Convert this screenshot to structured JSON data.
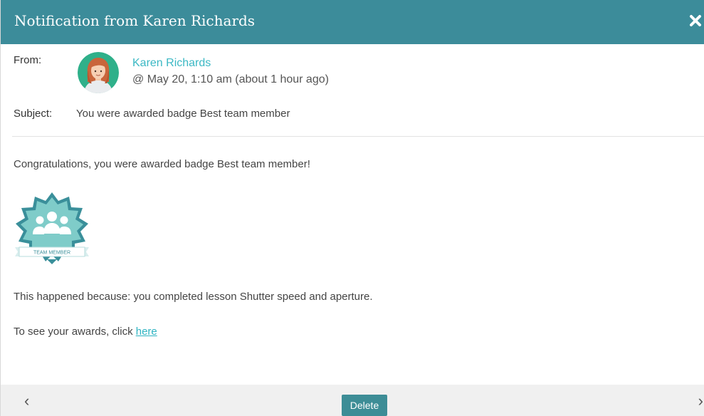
{
  "header": {
    "title": "Notification from Karen Richards",
    "close_icon": "close-icon",
    "bg_color": "#3c8c9a"
  },
  "from": {
    "label": "From:",
    "avatar_icon": "avatar-woman",
    "sender_name": "Karen Richards",
    "timestamp": "@ May 20, 1:10 am (about 1 hour ago)"
  },
  "subject": {
    "label": "Subject:",
    "text": "You were awarded badge Best team member"
  },
  "body": {
    "congrats": "Congratulations, you were awarded badge Best team member!",
    "badge_label": "TEAM MEMBER",
    "reason": "This happened because: you completed lesson Shutter speed and aperture.",
    "awards_prefix": "To see your awards, click ",
    "awards_link": "here"
  },
  "footer": {
    "prev_icon": "chevron-left-icon",
    "next_icon": "chevron-right-icon",
    "prev_glyph": "‹",
    "next_glyph": "›",
    "delete_label": "Delete"
  },
  "colors": {
    "accent": "#3bb8c4",
    "delete_button": "#3d8d96"
  }
}
